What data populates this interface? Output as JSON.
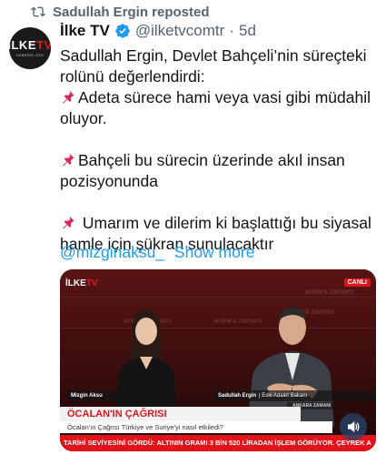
{
  "repost": {
    "label": "Sadullah Ergin reposted"
  },
  "author": {
    "name": "İlke TV",
    "handle": "@ilketvcomtr",
    "separator": "·",
    "time": "5d",
    "avatar_text_main": "İLKE",
    "avatar_text_accent": "TV",
    "avatar_sub": "HABERİN ÖZÜ"
  },
  "tweet": {
    "line1": "Sadullah Ergin, Devlet Bahçeli’nin süreçteki rolünü değerlendirdi:",
    "point1": "Adeta sürece hami veya vasi gibi müdahil oluyor.",
    "point2": "Bahçeli bu sürecin üzerinde akıl insan pozisyonunda",
    "point3": " Umarım ve dilerim ki başlattığı bu siyasal hamle için şükran sunulacaktır",
    "mention": "@mizginaksu_",
    "show_more": "Show more"
  },
  "media": {
    "channel_logo_main": "İLKE",
    "channel_logo_accent": "TV",
    "live_badge": "CANLI",
    "bg_text": "ankara zamanı",
    "left_name": "Mizgin Aksu",
    "right_name": "Sadullah Ergin",
    "right_title": "| Eski Adalet Bakanı",
    "location": "ANKARA ZAMANI",
    "headline": "ÖCALAN'IN ÇAĞRISI",
    "subheadline": "Öcalan'ın Çağrısı Türkiye ve Suriye'yi nasıl etkiledi?",
    "ticker": "TARİHİ SEVİYESİNİ GÖRDÜ: ALTININ GRAMI 3 BİN 520 LİRADAN İŞLEM GÖRÜYOR. ÇEYREK A"
  },
  "colors": {
    "accent_blue": "#1d9bf0",
    "brand_red": "#e2141b",
    "muted": "#536471"
  }
}
